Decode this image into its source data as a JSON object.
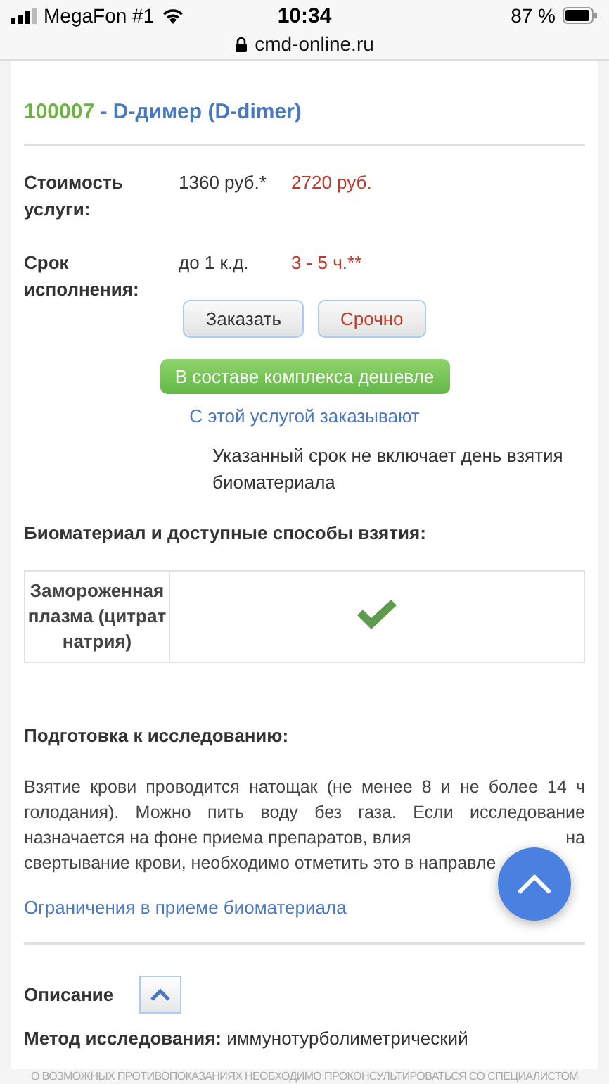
{
  "status_bar": {
    "carrier": "MegaFon #1",
    "time": "10:34",
    "battery": "87 %"
  },
  "address_bar": {
    "url": "cmd-online.ru"
  },
  "title": {
    "code": "100007",
    "name": " - D-димер (D-dimer)"
  },
  "details": [
    {
      "label": "Стоимость услуги:",
      "value": "1360 руб.*",
      "urgent_value": "2720 руб."
    },
    {
      "label": "Срок исполнения:",
      "value": "до 1 к.д.",
      "urgent_value": "3 - 5 ч.**"
    }
  ],
  "buttons": [
    {
      "label": "Заказать",
      "kind": "normal"
    },
    {
      "label": "Срочно",
      "kind": "urgent"
    }
  ],
  "complex_button": "В составе комплекса дешевле",
  "also_ordered_link": "С этой услугой заказывают",
  "term_note": "Указанный срок не включает день взятия биоматериала",
  "biomaterial": {
    "heading": "Биоматериал и доступные способы взятия:",
    "rows": [
      {
        "name": "Замороженная плазма (цитрат натрия)",
        "available": true
      }
    ]
  },
  "preparation": {
    "heading": "Подготовка к исследованию:",
    "lines": [
      [
        "Взятие крови проводится натощак (не менее 8 и не более 14 ч"
      ],
      [
        "голодания). Можно пить воду без газа. Если исследование"
      ],
      [
        "назначается на фоне приема препаратов, влия",
        "на"
      ],
      [
        "свертывание крови, необходимо отметить это в направле"
      ]
    ],
    "restrictions_link": "Ограничения в приеме биоматериала"
  },
  "description": {
    "heading": "Описание",
    "expanded": true,
    "method_label": "Метод исследования:",
    "method_value": " иммунотурболиметрический"
  },
  "disclaimer": "О ВОЗМОЖНЫХ ПРОТИВОПОКАЗАНИЯХ НЕОБХОДИМО ПРОКОНСУЛЬТИРОВАТЬСЯ СО СПЕЦИАЛИСТОМ"
}
